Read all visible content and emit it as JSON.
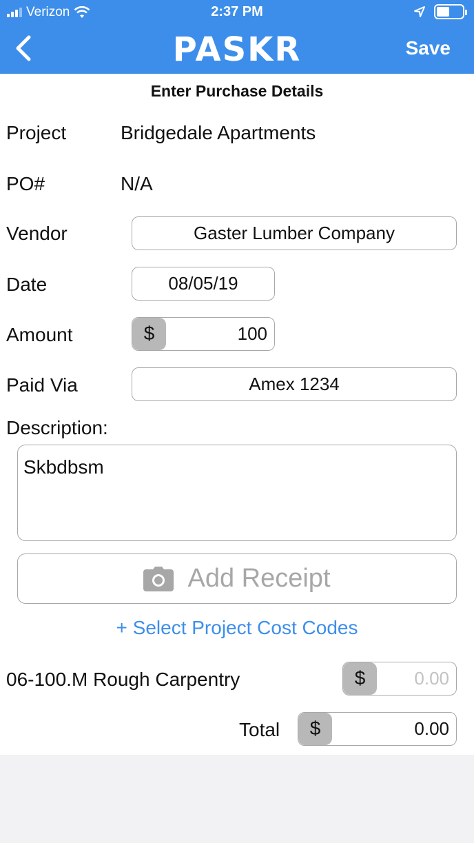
{
  "status_bar": {
    "carrier": "Verizon",
    "time": "2:37 PM"
  },
  "header": {
    "logo": "PASKR",
    "save_label": "Save"
  },
  "form": {
    "subtitle": "Enter Purchase Details",
    "project_label": "Project",
    "project_value": "Bridgedale Apartments",
    "po_label": "PO#",
    "po_value": "N/A",
    "vendor_label": "Vendor",
    "vendor_value": "Gaster Lumber Company",
    "date_label": "Date",
    "date_value": "08/05/19",
    "amount_label": "Amount",
    "currency_symbol": "$",
    "amount_value": "100",
    "paid_via_label": "Paid Via",
    "paid_via_value": "Amex 1234",
    "description_label": "Description:",
    "description_value": "Skbdbsm",
    "add_receipt_label": "Add Receipt",
    "select_cost_codes_label": "+ Select Project Cost Codes"
  },
  "cost_codes": [
    {
      "label": "06-100.M Rough Carpentry",
      "placeholder": "0.00"
    }
  ],
  "total": {
    "label": "Total",
    "value": "0.00"
  },
  "colors": {
    "accent": "#3d8eea",
    "border": "#a8a8a8",
    "currency_bg": "#b8b8b8"
  }
}
